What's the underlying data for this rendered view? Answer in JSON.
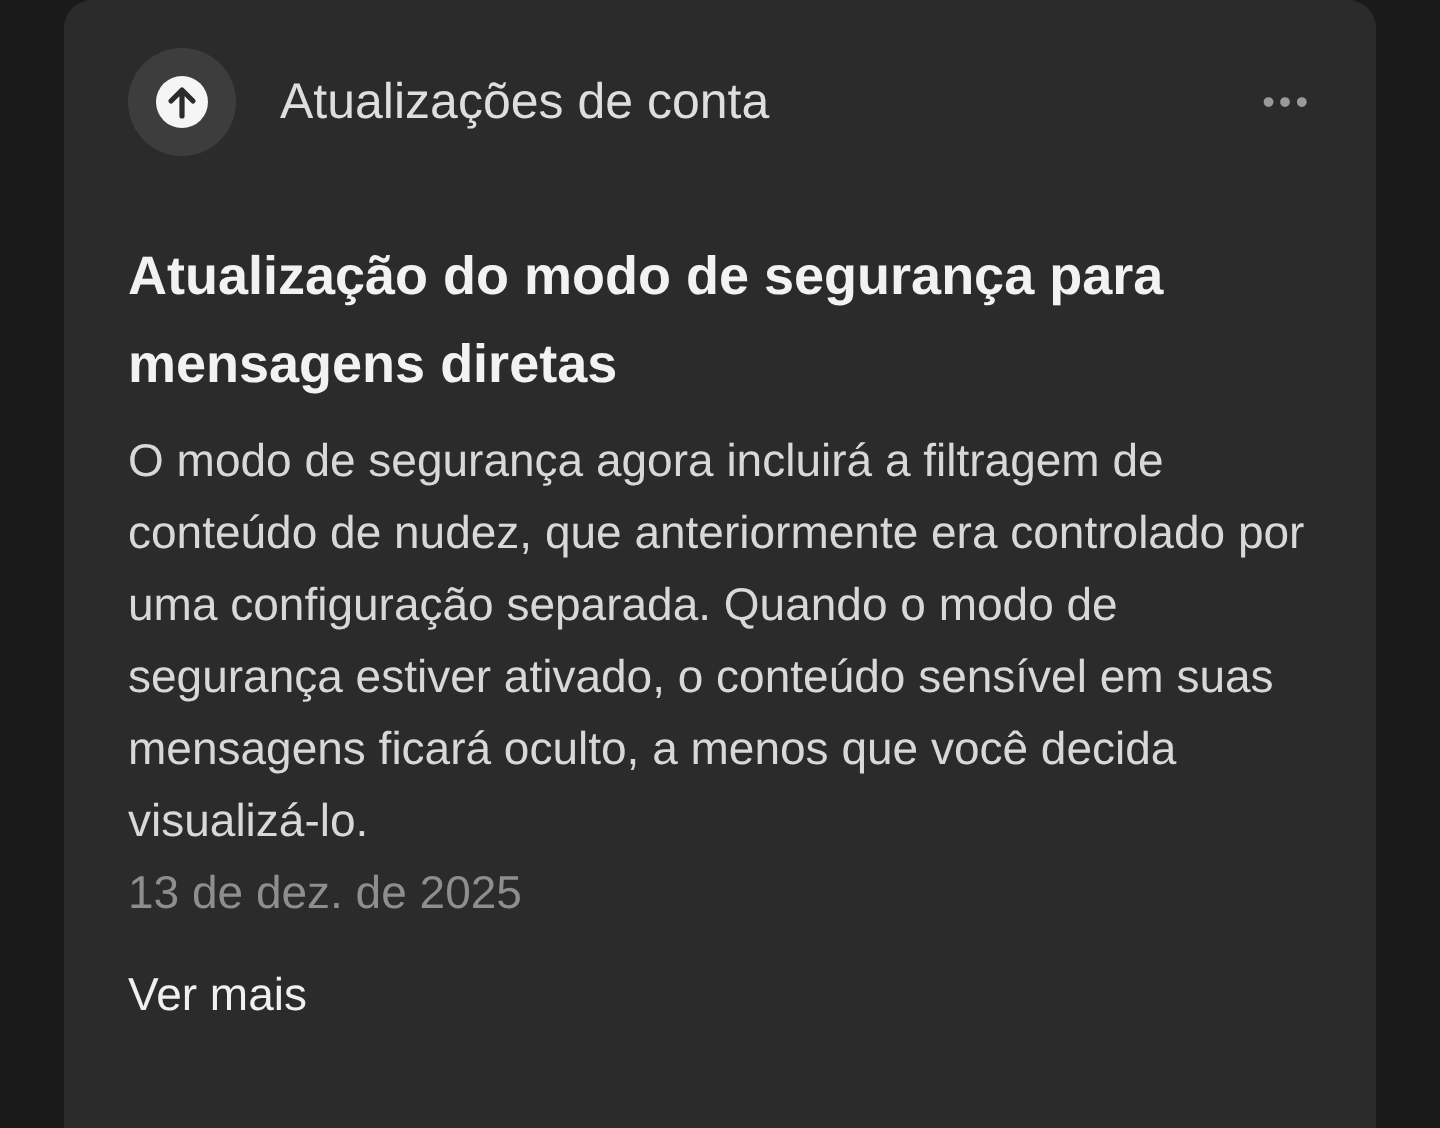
{
  "header": {
    "title": "Atualizações de conta",
    "menu": "•••"
  },
  "notice": {
    "title": "Atualização do modo de segurança para mensagens diretas",
    "body": "O modo de segurança agora incluirá a filtragem de conteúdo de nudez, que anteriormente era controlado por uma configuração separada. Quando o modo de segurança estiver ativado, o conteúdo sensível em suas mensagens ficará oculto, a menos que você decida visualizá-lo.",
    "date": "13 de dez. de 2025",
    "link": "Ver mais"
  }
}
